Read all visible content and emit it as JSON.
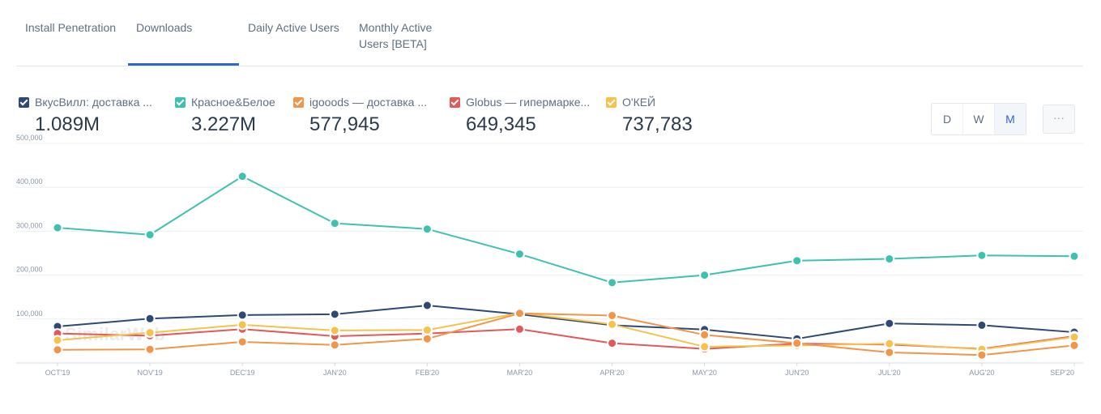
{
  "tabs": [
    {
      "label": "Install Penetration"
    },
    {
      "label": "Downloads"
    },
    {
      "label": "Daily Active Users"
    },
    {
      "label": "Monthly Active"
    },
    {
      "label": "Users [BETA]"
    }
  ],
  "active_tab": "Downloads",
  "legend": [
    {
      "label": "ВкусВилл: доставка ...",
      "value": "1.089M",
      "color": "#2e4a72"
    },
    {
      "label": "Красное&Белое",
      "value": "3.227M",
      "color": "#3fc1b0"
    },
    {
      "label": "igooods — доставка ...",
      "value": "577,945",
      "color": "#f0954a"
    },
    {
      "label": "Globus — гипермарке...",
      "value": "649,345",
      "color": "#e05a5a"
    },
    {
      "label": "О'КЕЙ",
      "value": "737,783",
      "color": "#f5c24e"
    }
  ],
  "granularity": {
    "options": [
      "D",
      "W",
      "M"
    ],
    "selected": "M"
  },
  "more_label": "···",
  "watermark": "SimilarWeb",
  "chart_data": {
    "type": "line",
    "categories": [
      "OCT'19",
      "NOV'19",
      "DEC'19",
      "JAN'20",
      "FEB'20",
      "MAR'20",
      "APR'20",
      "MAY'20",
      "JUN'20",
      "JUL'20",
      "AUG'20",
      "SEP'20"
    ],
    "y_ticks": [
      "500,000",
      "400,000",
      "300,000",
      "200,000",
      "100,000"
    ],
    "ylim": [
      0,
      500000
    ],
    "grid": true,
    "series": [
      {
        "name": "Красное&Белое",
        "color": "#3fc1b0",
        "values": [
          308000,
          292000,
          425000,
          318000,
          305000,
          248000,
          183000,
          200000,
          233000,
          237000,
          245000,
          243000
        ]
      },
      {
        "name": "ВкусВилл: доставка ...",
        "color": "#2e4a72",
        "values": [
          83000,
          101000,
          109000,
          111000,
          131000,
          111000,
          86000,
          76000,
          55000,
          90000,
          86000,
          70000
        ]
      },
      {
        "name": "Globus — гипермарке...",
        "color": "#e05a5a",
        "values": [
          67000,
          62000,
          77000,
          61000,
          67000,
          77000,
          45000,
          32000,
          44000,
          42000,
          32000,
          61000
        ]
      },
      {
        "name": "О'КЕЙ",
        "color": "#f5c24e",
        "values": [
          52000,
          69000,
          87000,
          74000,
          75000,
          114000,
          88000,
          37000,
          40000,
          44000,
          31000,
          59000
        ]
      },
      {
        "name": "igooods — доставка ...",
        "color": "#f0954a",
        "values": [
          30000,
          31000,
          48000,
          41000,
          55000,
          113000,
          108000,
          64000,
          45000,
          24000,
          18000,
          40000
        ]
      }
    ]
  }
}
